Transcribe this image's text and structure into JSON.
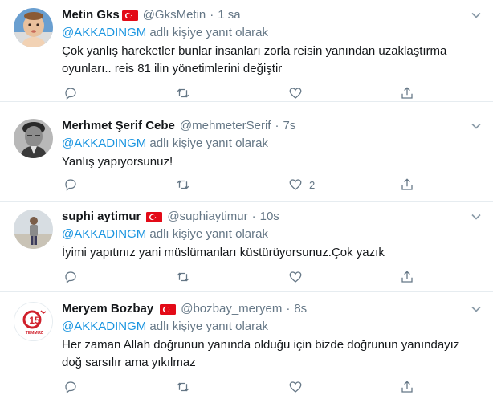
{
  "tweets": [
    {
      "name": "Metin Gks",
      "handle": "@GksMetin",
      "time": "1 sa",
      "reply_to": "@AKKADINGM",
      "reply_suffix": " adlı kişiye yanıt olarak",
      "text": "Çok yanlış hareketler bunlar insanları zorla reisin yanından uzaklaştırma oyunları.. reis 81 ilin yönetimlerini değiştir",
      "like_count": ""
    },
    {
      "name": "Merhmet Şerif Cebe",
      "handle": "@mehmeterSerif",
      "time": "7s",
      "reply_to": "@AKKADINGM",
      "reply_suffix": " adlı kişiye yanıt olarak",
      "text": "Yanlış yapıyorsunuz!",
      "like_count": "2"
    },
    {
      "name": "suphi aytimur",
      "handle": "@suphiaytimur",
      "time": "10s",
      "reply_to": "@AKKADINGM",
      "reply_suffix": " adlı kişiye yanıt olarak",
      "text": "İyimi yapıtınız yani müslümanları küstürüyorsunuz.Çok yazık",
      "like_count": ""
    },
    {
      "name": "Meryem Bozbay",
      "handle": "@bozbay_meryem",
      "time": "8s",
      "reply_to": "@AKKADINGM",
      "reply_suffix": " adlı kişiye yanıt olarak",
      "text": "Her zaman Allah doğrunun yanında olduğu için bizde doğrunun yanındayız doğ sarsılır ama yıkılmaz",
      "like_count": ""
    }
  ],
  "avatar4_logo_text": "15 TEMMUZ",
  "colors": {
    "accent": "#1b95e0",
    "muted": "#657786",
    "border": "#e6ecf0",
    "flag_red": "#e30a17"
  }
}
